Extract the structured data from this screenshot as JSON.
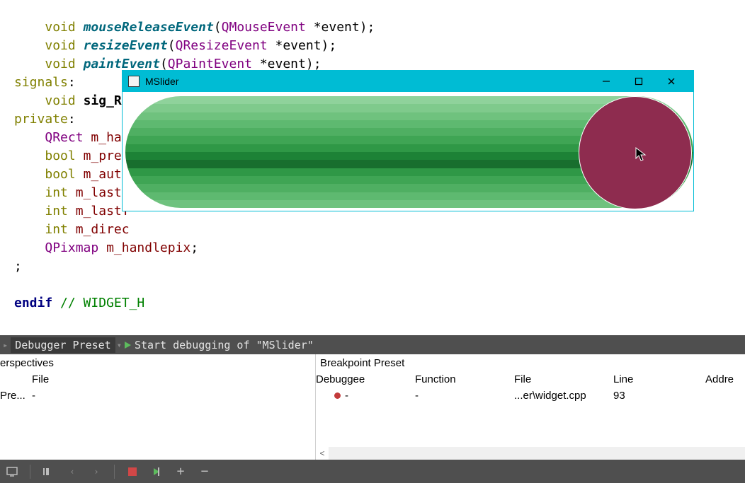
{
  "code": {
    "l1": {
      "kw": "void",
      "fn": "mouseReleaseEvent",
      "args_open": "(",
      "type": "QMouseEvent",
      "args_rest": " *event);"
    },
    "l2": {
      "kw": "void",
      "fn": "resizeEvent",
      "args_open": "(",
      "type": "QResizeEvent",
      "args_rest": " *event);"
    },
    "l3": {
      "kw": "void",
      "fn": "paintEvent",
      "args_open": "(",
      "type": "QPaintEvent",
      "args_rest": " *event);"
    },
    "l4": {
      "kw": "signals",
      "colon": ":"
    },
    "l5": {
      "kw": "void",
      "fn": "sig_Ru"
    },
    "l6": {
      "kw": "private",
      "colon": ":"
    },
    "l7": {
      "type": "QRect",
      "mem": "m_ha"
    },
    "l8": {
      "kw": "bool",
      "mem": "m_pres"
    },
    "l9": {
      "kw": "bool",
      "mem": "m_auto"
    },
    "l10": {
      "kw": "int",
      "mem": "m_lastX"
    },
    "l11": {
      "kw": "int",
      "mem": "m_lastY"
    },
    "l12": {
      "kw": "int",
      "mem": "m_direc"
    },
    "l13": {
      "type": "QPixmap",
      "mem": "m_handlepix",
      "tail": ";"
    },
    "l14": {
      "plain": ";"
    },
    "l15": {
      "pp": "endif",
      "cmt": " // WIDGET_H"
    }
  },
  "mslider_window": {
    "title": "MSlider",
    "handle_color": "#8e2c4f",
    "track_stripes": [
      "#8fd29b",
      "#7fca8c",
      "#6fc27e",
      "#5eb970",
      "#4faf62",
      "#3fa554",
      "#2f9846",
      "#1d8236",
      "#186e2e",
      "#2f9846",
      "#3fa554",
      "#4faf62",
      "#5eb970",
      "#6fc27e"
    ]
  },
  "dbg_toolbar": {
    "preset": "Debugger Preset",
    "start_label": "Start debugging of \"MSlider\""
  },
  "left_pane": {
    "title": "erspectives",
    "col_file": "File",
    "row1_left": "Pre...",
    "row1_file": "-"
  },
  "right_pane": {
    "title": "Breakpoint Preset",
    "cols": {
      "debuggee": "Debuggee",
      "function": "Function",
      "file": "File",
      "line": "Line",
      "addr": "Addre"
    },
    "row1": {
      "debuggee": "-",
      "function": "-",
      "file": "...er\\widget.cpp",
      "line": "93"
    }
  }
}
